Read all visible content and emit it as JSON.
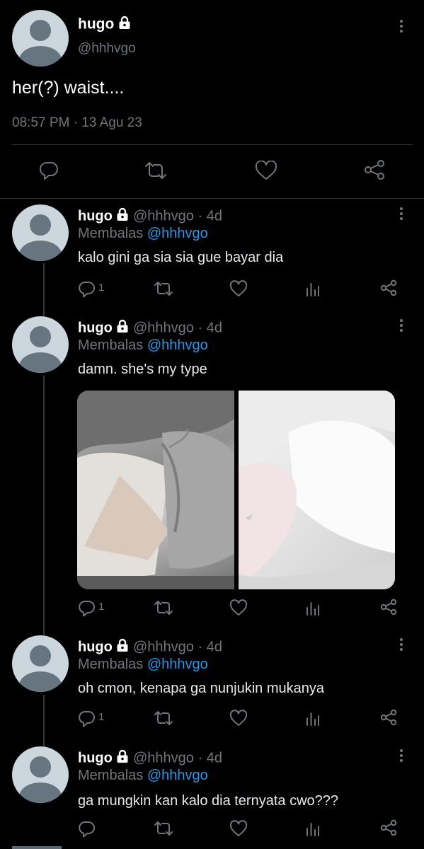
{
  "main_tweet": {
    "display_name": "hugo",
    "handle": "@hhhvgo",
    "text": "her(?) waist....",
    "time": "08:57 PM",
    "separator": "·",
    "date": "13 Agu 23"
  },
  "replies": [
    {
      "display_name": "hugo",
      "handle": "@hhhvgo",
      "age": "· 4d",
      "reply_label": "Membalas",
      "reply_to": "@hhhvgo",
      "text": "kalo gini ga sia sia gue bayar dia",
      "reply_count": "1"
    },
    {
      "display_name": "hugo",
      "handle": "@hhhvgo",
      "age": "· 4d",
      "reply_label": "Membalas",
      "reply_to": "@hhhvgo",
      "text": "damn. she's my type",
      "reply_count": "1"
    },
    {
      "display_name": "hugo",
      "handle": "@hhhvgo",
      "age": "· 4d",
      "reply_label": "Membalas",
      "reply_to": "@hhhvgo",
      "text": "oh cmon, kenapa ga nunjukin mukanya",
      "reply_count": "1"
    },
    {
      "display_name": "hugo",
      "handle": "@hhhvgo",
      "age": "· 4d",
      "reply_label": "Membalas",
      "reply_to": "@hhhvgo",
      "text": "ga mungkin kan kalo dia ternyata cwo???",
      "reply_count": ""
    }
  ],
  "icons": {
    "reply": "speech-bubble-icon",
    "retweet": "retweet-icon",
    "like": "heart-icon",
    "views": "bar-chart-icon",
    "share": "share-icon",
    "more": "kebab-menu-icon",
    "lock": "lock-icon"
  },
  "colors": {
    "background": "#000000",
    "text": "#e7e9ea",
    "muted": "#71767b",
    "link": "#1d9bf0",
    "divider": "#2f3336",
    "avatar_bg": "#ccd6dd",
    "avatar_fg": "#66757f"
  }
}
